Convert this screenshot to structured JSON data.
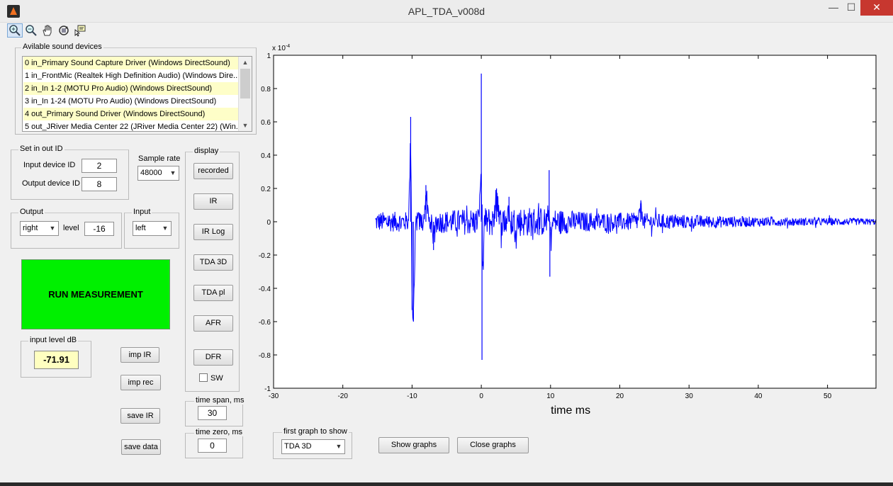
{
  "window": {
    "title": "APL_TDA_v008d",
    "minimize_glyph": "—",
    "maximize_glyph": "☐",
    "close_glyph": "✕"
  },
  "toolbar": {
    "icons": [
      "zoom-in-icon",
      "zoom-out-icon",
      "pan-hand-icon",
      "rotate-3d-icon",
      "data-cursor-icon"
    ]
  },
  "devices": {
    "label": "Avilable sound devices",
    "items": [
      "0 in_Primary Sound Capture Driver (Windows DirectSound)",
      "1 in_FrontMic (Realtek High Definition Audio) (Windows Dire...",
      "2 in_In 1-2 (MOTU Pro Audio) (Windows DirectSound)",
      "3 in_In 1-24 (MOTU Pro Audio) (Windows DirectSound)",
      "4 out_Primary Sound Driver (Windows DirectSound)",
      "5 out_JRiver Media Center 22 (JRiver Media Center 22) (Win..."
    ]
  },
  "set_io": {
    "label": "Set in out ID",
    "input_label": "Input device ID",
    "input_value": "2",
    "output_label": "Output device ID",
    "output_value": "8"
  },
  "sample_rate": {
    "label": "Sample rate",
    "value": "48000"
  },
  "output": {
    "label": "Output",
    "channel": "right",
    "level_label": "level",
    "level_value": "-16"
  },
  "input": {
    "label": "Input",
    "channel": "left"
  },
  "run_button": "RUN MEASUREMENT",
  "input_level": {
    "label": "input level dB",
    "value": "-71.91"
  },
  "buttons": {
    "imp_ir": "imp IR",
    "imp_rec": "imp rec",
    "save_ir": "save IR",
    "save_data": "save data",
    "show_graphs": "Show graphs",
    "close_graphs": "Close graphs"
  },
  "display": {
    "label": "display",
    "buttons": [
      "recorded",
      "IR",
      "IR Log",
      "TDA 3D",
      "TDA pl",
      "AFR",
      "DFR"
    ],
    "sw_label": "SW",
    "sw_checked": false
  },
  "time_span": {
    "label": "time span, ms",
    "value": "30"
  },
  "time_zero": {
    "label": "time zero, ms",
    "value": "0"
  },
  "first_graph": {
    "label": "first graph to show",
    "value": "TDA 3D"
  },
  "chart_data": {
    "type": "line",
    "xlabel": "time  ms",
    "ylabel": "",
    "y_exponent_label": "x 10",
    "y_exponent_power": "-4",
    "xlim": [
      -30,
      57
    ],
    "ylim": [
      -1,
      1
    ],
    "xticks": [
      -30,
      -20,
      -10,
      0,
      10,
      20,
      30,
      40,
      50
    ],
    "yticks": [
      -1,
      -0.8,
      -0.6,
      -0.4,
      -0.2,
      0,
      0.2,
      0.4,
      0.6,
      0.8,
      1
    ],
    "ytick_labels": [
      "-1",
      "-0.8",
      "-0.6",
      "-0.4",
      "-0.2",
      "0",
      "0.2",
      "0.4",
      "0.6",
      "0.8",
      "1"
    ],
    "line_color": "#0000ff",
    "grid": false,
    "signal_start_ms": -15.3,
    "peaks": [
      {
        "x": -10.2,
        "y": 0.63
      },
      {
        "x": -10.0,
        "y": -0.53
      },
      {
        "x": -9.8,
        "y": -0.6
      },
      {
        "x": -8.0,
        "y": 0.22
      },
      {
        "x": -6.9,
        "y": -0.17
      },
      {
        "x": 0.0,
        "y": 0.89
      },
      {
        "x": 0.1,
        "y": -0.83
      },
      {
        "x": 2.2,
        "y": 0.2
      },
      {
        "x": 4.0,
        "y": 0.15
      },
      {
        "x": 9.8,
        "y": 0.31
      },
      {
        "x": 9.9,
        "y": -0.33
      },
      {
        "x": 23.0,
        "y": 0.11
      }
    ],
    "envelope": [
      {
        "x": -15.3,
        "amp": 0.06
      },
      {
        "x": -11,
        "amp": 0.06
      },
      {
        "x": -5,
        "amp": 0.07
      },
      {
        "x": 1,
        "amp": 0.09
      },
      {
        "x": 8,
        "amp": 0.09
      },
      {
        "x": 15,
        "amp": 0.06
      },
      {
        "x": 25,
        "amp": 0.05
      },
      {
        "x": 35,
        "amp": 0.035
      },
      {
        "x": 45,
        "amp": 0.025
      },
      {
        "x": 57,
        "amp": 0.02
      }
    ]
  }
}
